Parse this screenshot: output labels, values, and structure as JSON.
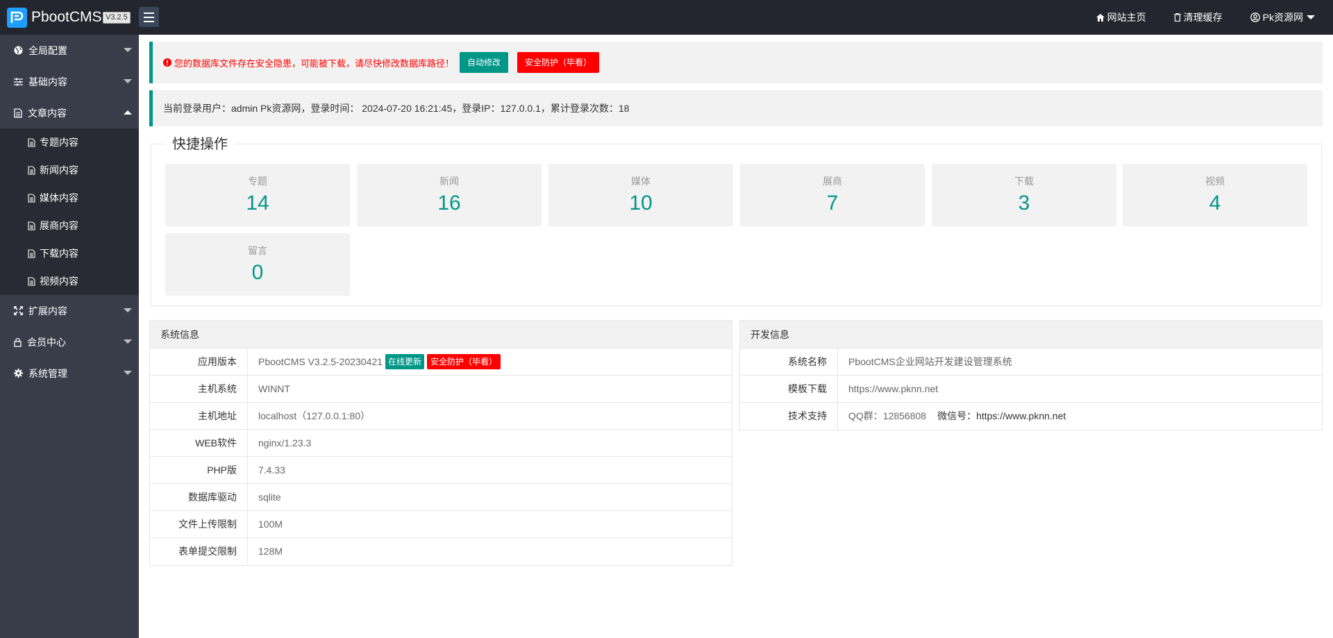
{
  "app": {
    "name": "PbootCMS",
    "version": "V3.2.5"
  },
  "topnav": {
    "home": "网站主页",
    "clear_cache": "清理缓存",
    "user": "Pk资源网"
  },
  "sidebar": {
    "items": [
      {
        "label": "全局配置"
      },
      {
        "label": "基础内容"
      },
      {
        "label": "文章内容"
      },
      {
        "label": "扩展内容"
      },
      {
        "label": "会员中心"
      },
      {
        "label": "系统管理"
      }
    ],
    "subitems": [
      {
        "label": "专题内容"
      },
      {
        "label": "新闻内容"
      },
      {
        "label": "媒体内容"
      },
      {
        "label": "展商内容"
      },
      {
        "label": "下载内容"
      },
      {
        "label": "视频内容"
      }
    ]
  },
  "alert": {
    "warning": "您的数据库文件存在安全隐患，可能被下载，请尽快修改数据库路径！",
    "auto_fix": "自动修改",
    "security": "安全防护（毕看）"
  },
  "login_info": "当前登录用户：admin Pk资源网，登录时间： 2024-07-20 16:21:45，登录IP：127.0.0.1，累计登录次数：18",
  "quick": {
    "title": "快捷操作",
    "cards": [
      {
        "title": "专题",
        "count": "14"
      },
      {
        "title": "新闻",
        "count": "16"
      },
      {
        "title": "媒体",
        "count": "10"
      },
      {
        "title": "展商",
        "count": "7"
      },
      {
        "title": "下载",
        "count": "3"
      },
      {
        "title": "视频",
        "count": "4"
      },
      {
        "title": "留言",
        "count": "0"
      }
    ]
  },
  "sysinfo": {
    "title": "系统信息",
    "version_label": "应用版本",
    "version_value": "PbootCMS V3.2.5-20230421",
    "update_btn": "在线更新",
    "security_btn": "安全防护（毕看）",
    "rows": [
      {
        "k": "主机系统",
        "v": "WINNT"
      },
      {
        "k": "主机地址",
        "v": "localhost（127.0.0.1:80）"
      },
      {
        "k": "WEB软件",
        "v": "nginx/1.23.3"
      },
      {
        "k": "PHP版",
        "v": "7.4.33"
      },
      {
        "k": "数据库驱动",
        "v": "sqlite"
      },
      {
        "k": "文件上传限制",
        "v": "100M"
      },
      {
        "k": "表单提交限制",
        "v": "128M"
      }
    ]
  },
  "devinfo": {
    "title": "开发信息",
    "name_label": "系统名称",
    "name_value": "PbootCMS企业网站开发建设管理系统",
    "template_label": "模板下载",
    "template_value": "https://www.pknn.net",
    "support_label": "技术支持",
    "support_qq": "QQ群：12856808",
    "support_wechat_label": "微信号：",
    "support_wechat_value": "https://www.pknn.net"
  },
  "colors": {
    "accent": "#009688",
    "danger": "#ff0000",
    "topbar": "#23262e",
    "sidebar": "#393d49"
  }
}
